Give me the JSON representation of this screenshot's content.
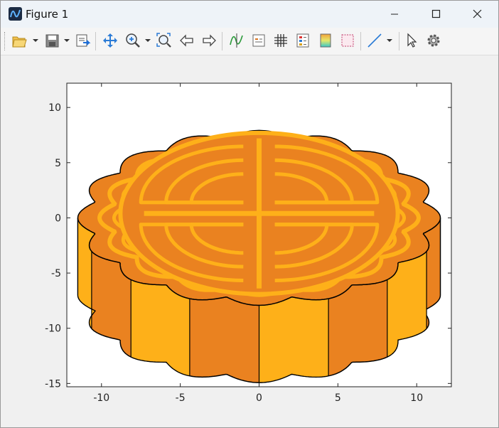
{
  "window": {
    "title": "Figure 1",
    "app_icon": "matlab-icon",
    "controls": [
      "minimize-icon",
      "maximize-icon",
      "close-icon"
    ]
  },
  "toolbar": {
    "buttons": [
      {
        "name": "open-file",
        "icon": "folder-open-icon",
        "dropdown": true
      },
      {
        "name": "save",
        "icon": "floppy-icon",
        "dropdown": true
      },
      {
        "name": "export",
        "icon": "export-icon"
      },
      {
        "name": "pan",
        "icon": "move-arrows-icon"
      },
      {
        "name": "zoom-in",
        "icon": "zoom-in-icon",
        "dropdown": true
      },
      {
        "name": "zoom-to-fit",
        "icon": "zoom-fit-icon"
      },
      {
        "name": "back",
        "icon": "arrow-left-icon"
      },
      {
        "name": "forward",
        "icon": "arrow-right-icon"
      },
      {
        "name": "data-cursor",
        "icon": "data-cursor-icon"
      },
      {
        "name": "legend",
        "icon": "legend-icon"
      },
      {
        "name": "grid",
        "icon": "grid-icon"
      },
      {
        "name": "insert-legend",
        "icon": "legend-box-icon"
      },
      {
        "name": "colorbar",
        "icon": "colorbar-icon"
      },
      {
        "name": "axes-box",
        "icon": "axes-box-icon"
      },
      {
        "name": "line-style",
        "icon": "line-icon",
        "dropdown": true
      },
      {
        "name": "select",
        "icon": "cursor-arrow-icon"
      },
      {
        "name": "settings",
        "icon": "gear-icon"
      }
    ]
  },
  "chart_data": {
    "type": "drawing",
    "subject": "mooncake",
    "title": "",
    "xlabel": "",
    "ylabel": "",
    "xlim": [
      -12.2,
      12.2
    ],
    "ylim": [
      -15.3,
      12.2
    ],
    "xticks": [
      -10,
      -5,
      0,
      5,
      10
    ],
    "yticks": [
      10,
      5,
      0,
      -5,
      -10,
      -15
    ],
    "xtick_labels": [
      "-10",
      "-5",
      "0",
      "5",
      "10"
    ],
    "ytick_labels": [
      "10",
      "5",
      "0",
      "-5",
      "-10",
      "-15"
    ],
    "grid": false,
    "colors": {
      "top": "#ea8220",
      "side_light": "#feb019",
      "side_dark": "#ea8220",
      "pattern": "#feb019",
      "outline": "#000000"
    }
  }
}
